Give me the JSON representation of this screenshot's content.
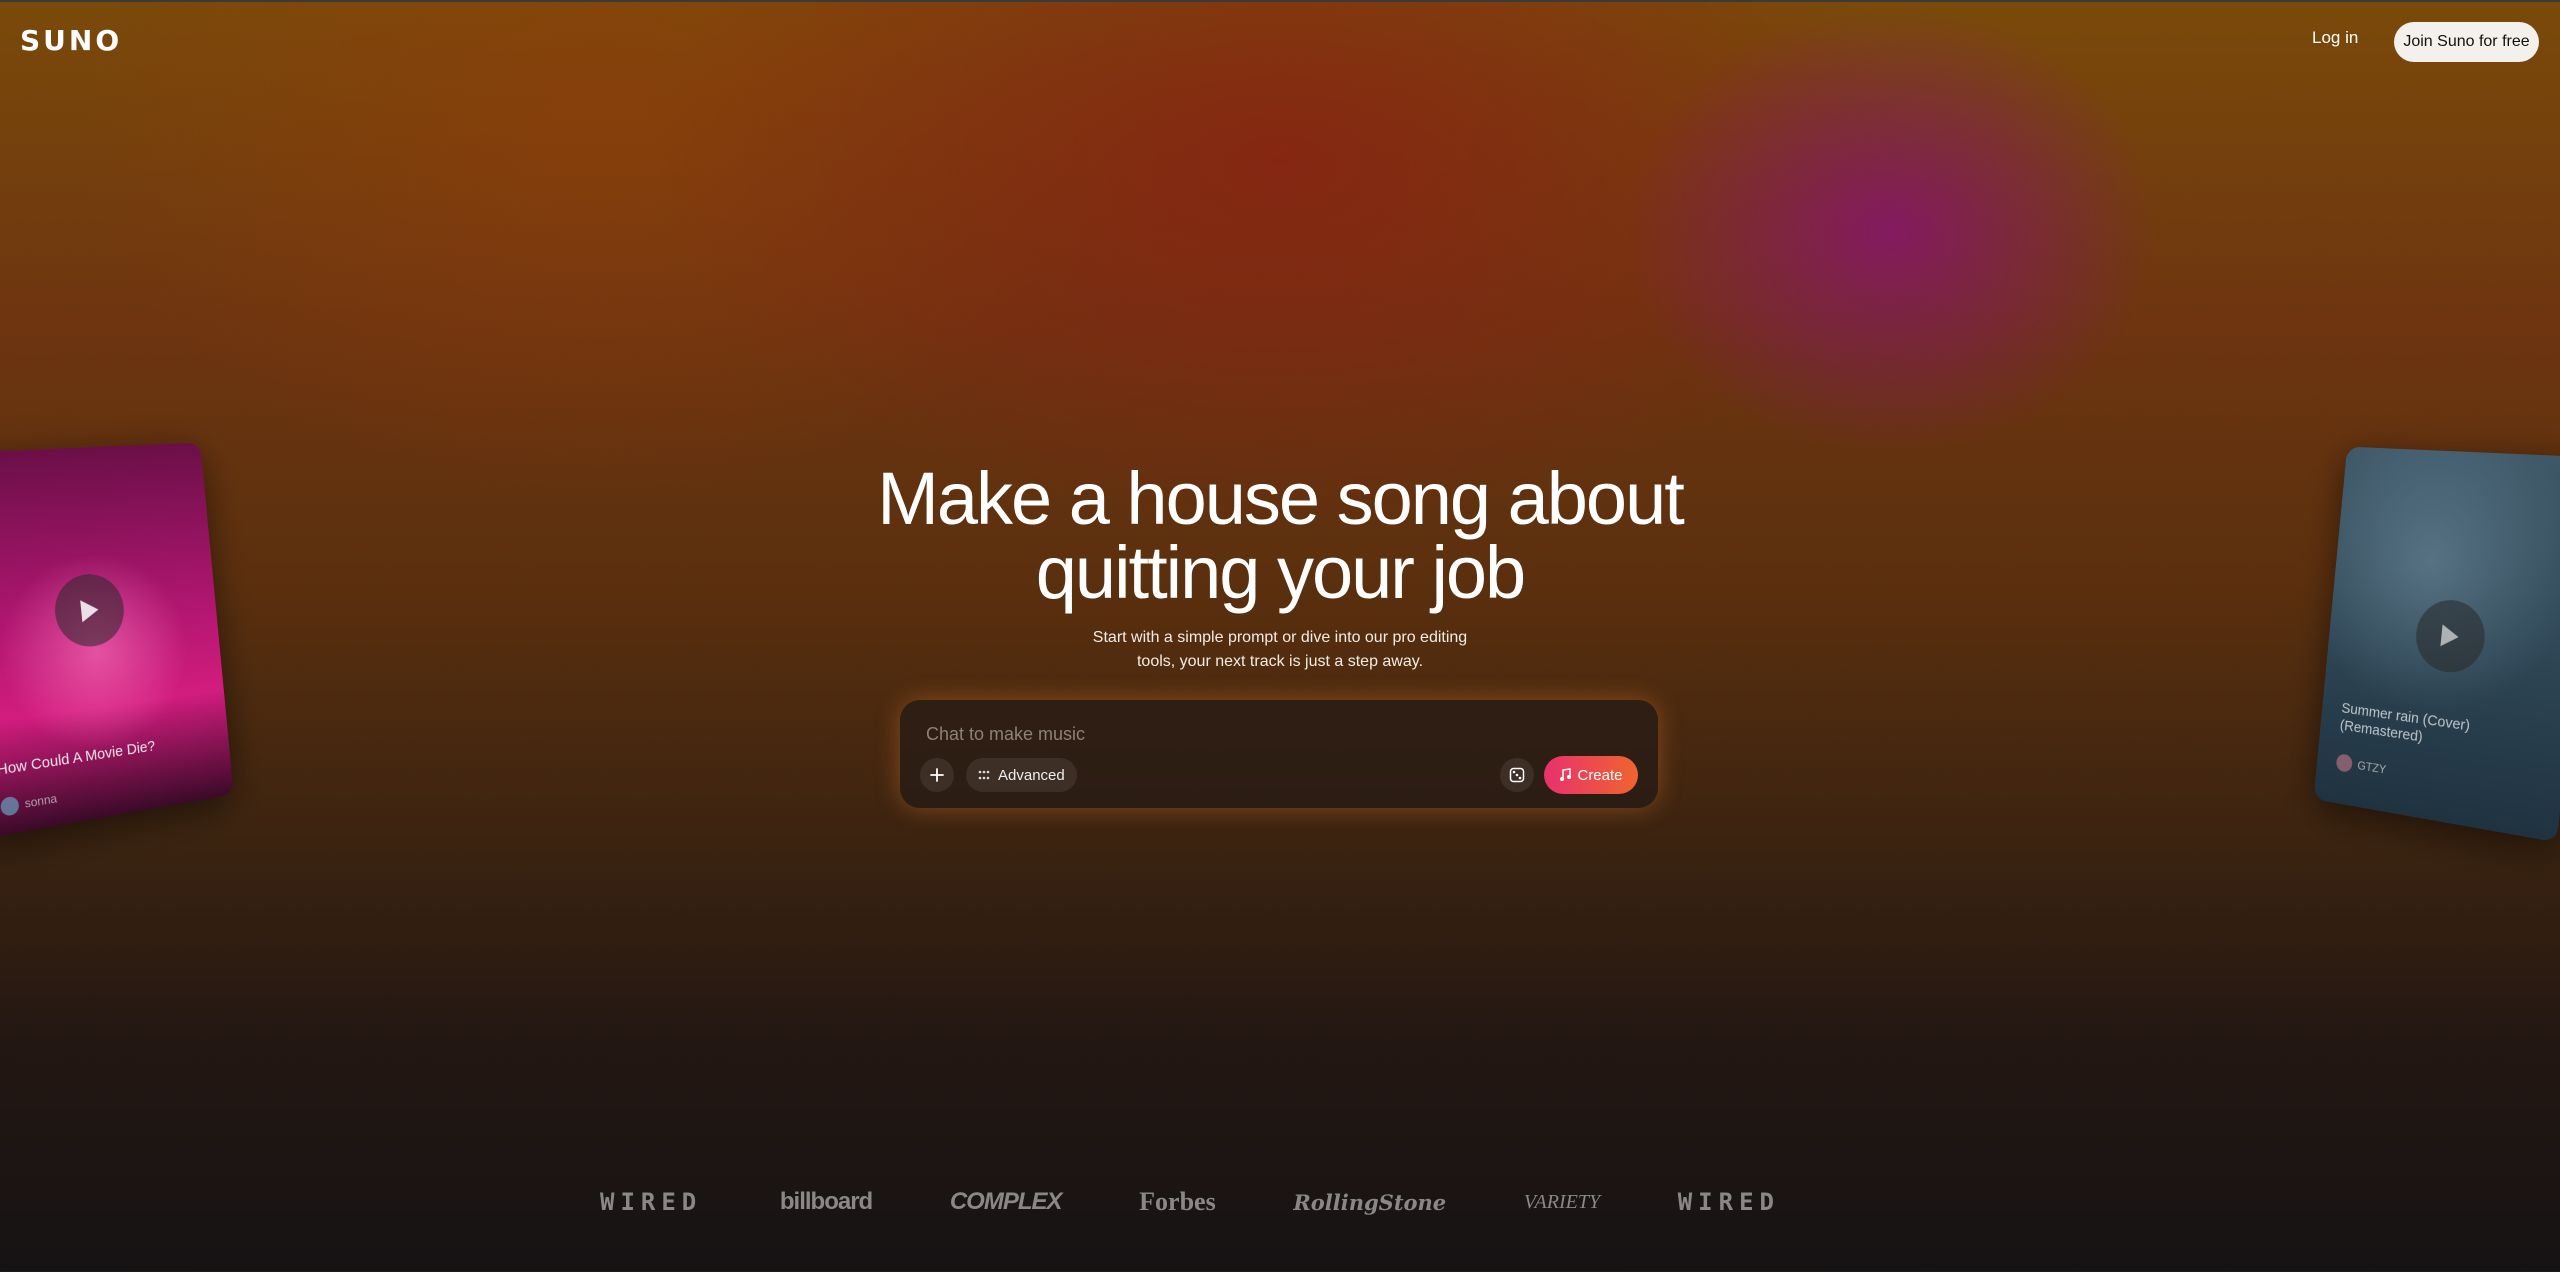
{
  "header": {
    "logo": "SUNO",
    "login_label": "Log in",
    "join_label": "Join Suno for free"
  },
  "hero": {
    "title_line1": "Make a house song about",
    "title_line2": "quitting your job",
    "subtitle_line1": "Start with a simple prompt or dive into our pro editing",
    "subtitle_line2": "tools, your next track is just a step away."
  },
  "prompt": {
    "placeholder": "Chat to make music",
    "advanced_label": "Advanced",
    "create_label": "Create",
    "icons": {
      "add": "plus-icon",
      "advanced": "sliders-icon",
      "random": "dice-icon",
      "create": "music-note-icon"
    },
    "create_gradient": [
      "#e8316e",
      "#f0642e"
    ]
  },
  "cards": {
    "left": {
      "title": "How Could A Movie Die?",
      "artist": "sonna"
    },
    "right": {
      "title": "Summer rain (Cover) (Remastered)",
      "artist": "GTZY"
    }
  },
  "press": [
    {
      "name": "WIRED"
    },
    {
      "name": "billboard"
    },
    {
      "name": "COMPLEX"
    },
    {
      "name": "Forbes"
    },
    {
      "name": "RollingStone"
    },
    {
      "name": "VARIETY"
    },
    {
      "name": "WIRED"
    }
  ]
}
